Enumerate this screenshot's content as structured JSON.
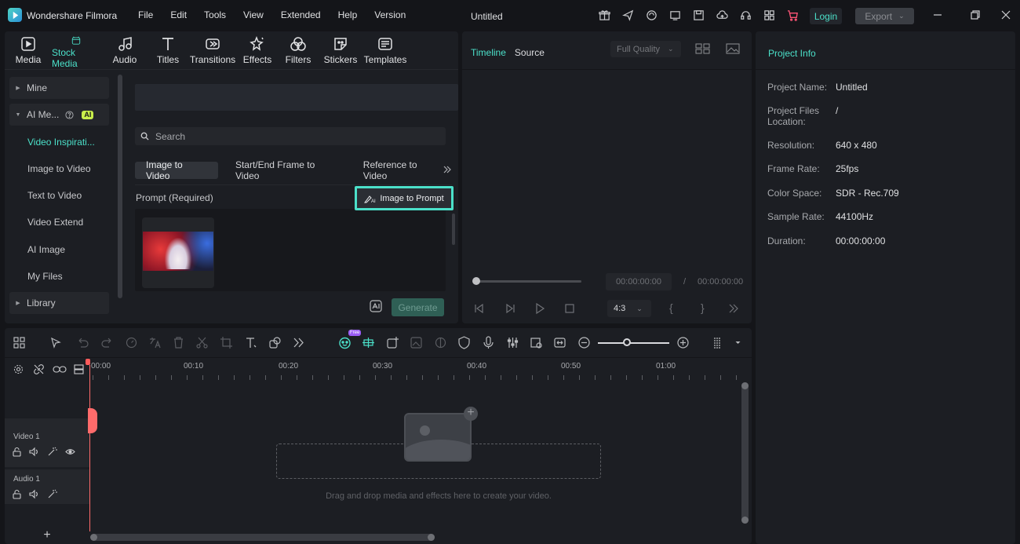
{
  "app": {
    "name": "Wondershare Filmora",
    "document_title": "Untitled",
    "login_label": "Login",
    "export_label": "Export"
  },
  "menu": [
    "File",
    "Edit",
    "Tools",
    "View",
    "Extended",
    "Help",
    "Version"
  ],
  "category_tabs": [
    {
      "label": "Media",
      "icon": "media-icon"
    },
    {
      "label": "Stock Media",
      "icon": "stock-media-icon",
      "active": true
    },
    {
      "label": "Audio",
      "icon": "music-note-icon"
    },
    {
      "label": "Titles",
      "icon": "text-t-icon"
    },
    {
      "label": "Transitions",
      "icon": "transitions-icon"
    },
    {
      "label": "Effects",
      "icon": "effects-star-icon"
    },
    {
      "label": "Filters",
      "icon": "filters-icon"
    },
    {
      "label": "Stickers",
      "icon": "stickers-icon"
    },
    {
      "label": "Templates",
      "icon": "templates-icon"
    }
  ],
  "sidebar": {
    "mine": "Mine",
    "ai_media": "AI Me...",
    "ai_badge": "AI",
    "items": [
      "Video Inspirati...",
      "Image to Video",
      "Text to Video",
      "Video Extend",
      "AI Image",
      "My Files"
    ],
    "library": "Library"
  },
  "content": {
    "search_placeholder": "Search",
    "mode_tabs": [
      "Image to Video",
      "Start/End Frame to Video",
      "Reference to Video"
    ],
    "prompt_label": "Prompt (Required)",
    "image_to_prompt_label": "Image to Prompt",
    "generate_label": "Generate"
  },
  "preview": {
    "tabs": [
      "Timeline",
      "Source"
    ],
    "quality": "Full Quality",
    "current_time": "00:00:00:00",
    "separator": "/",
    "total_time": "00:00:00:00",
    "ratio": "4:3",
    "progress": 0
  },
  "project_info": {
    "title": "Project Info",
    "rows": [
      {
        "key": "Project Name:",
        "value": "Untitled"
      },
      {
        "key": "Project Files Location:",
        "value": "/"
      },
      {
        "key": "Resolution:",
        "value": "640 x 480"
      },
      {
        "key": "Frame Rate:",
        "value": "25fps"
      },
      {
        "key": "Color Space:",
        "value": "SDR - Rec.709"
      },
      {
        "key": "Sample Rate:",
        "value": "44100Hz"
      },
      {
        "key": "Duration:",
        "value": "00:00:00:00"
      }
    ]
  },
  "timeline": {
    "free_badge": "Free",
    "ruler": [
      "00:00",
      "00:10",
      "00:20",
      "00:30",
      "00:40",
      "00:50",
      "01:00"
    ],
    "tracks": [
      "Video 1",
      "Audio 1"
    ],
    "drop_text": "Drag and drop media and effects here to create your video.",
    "zoom_level": 0.38
  },
  "colors": {
    "accent": "#4be0c9",
    "background": "#141519",
    "panel": "#1c1e23",
    "playhead": "#ff6b6b"
  }
}
